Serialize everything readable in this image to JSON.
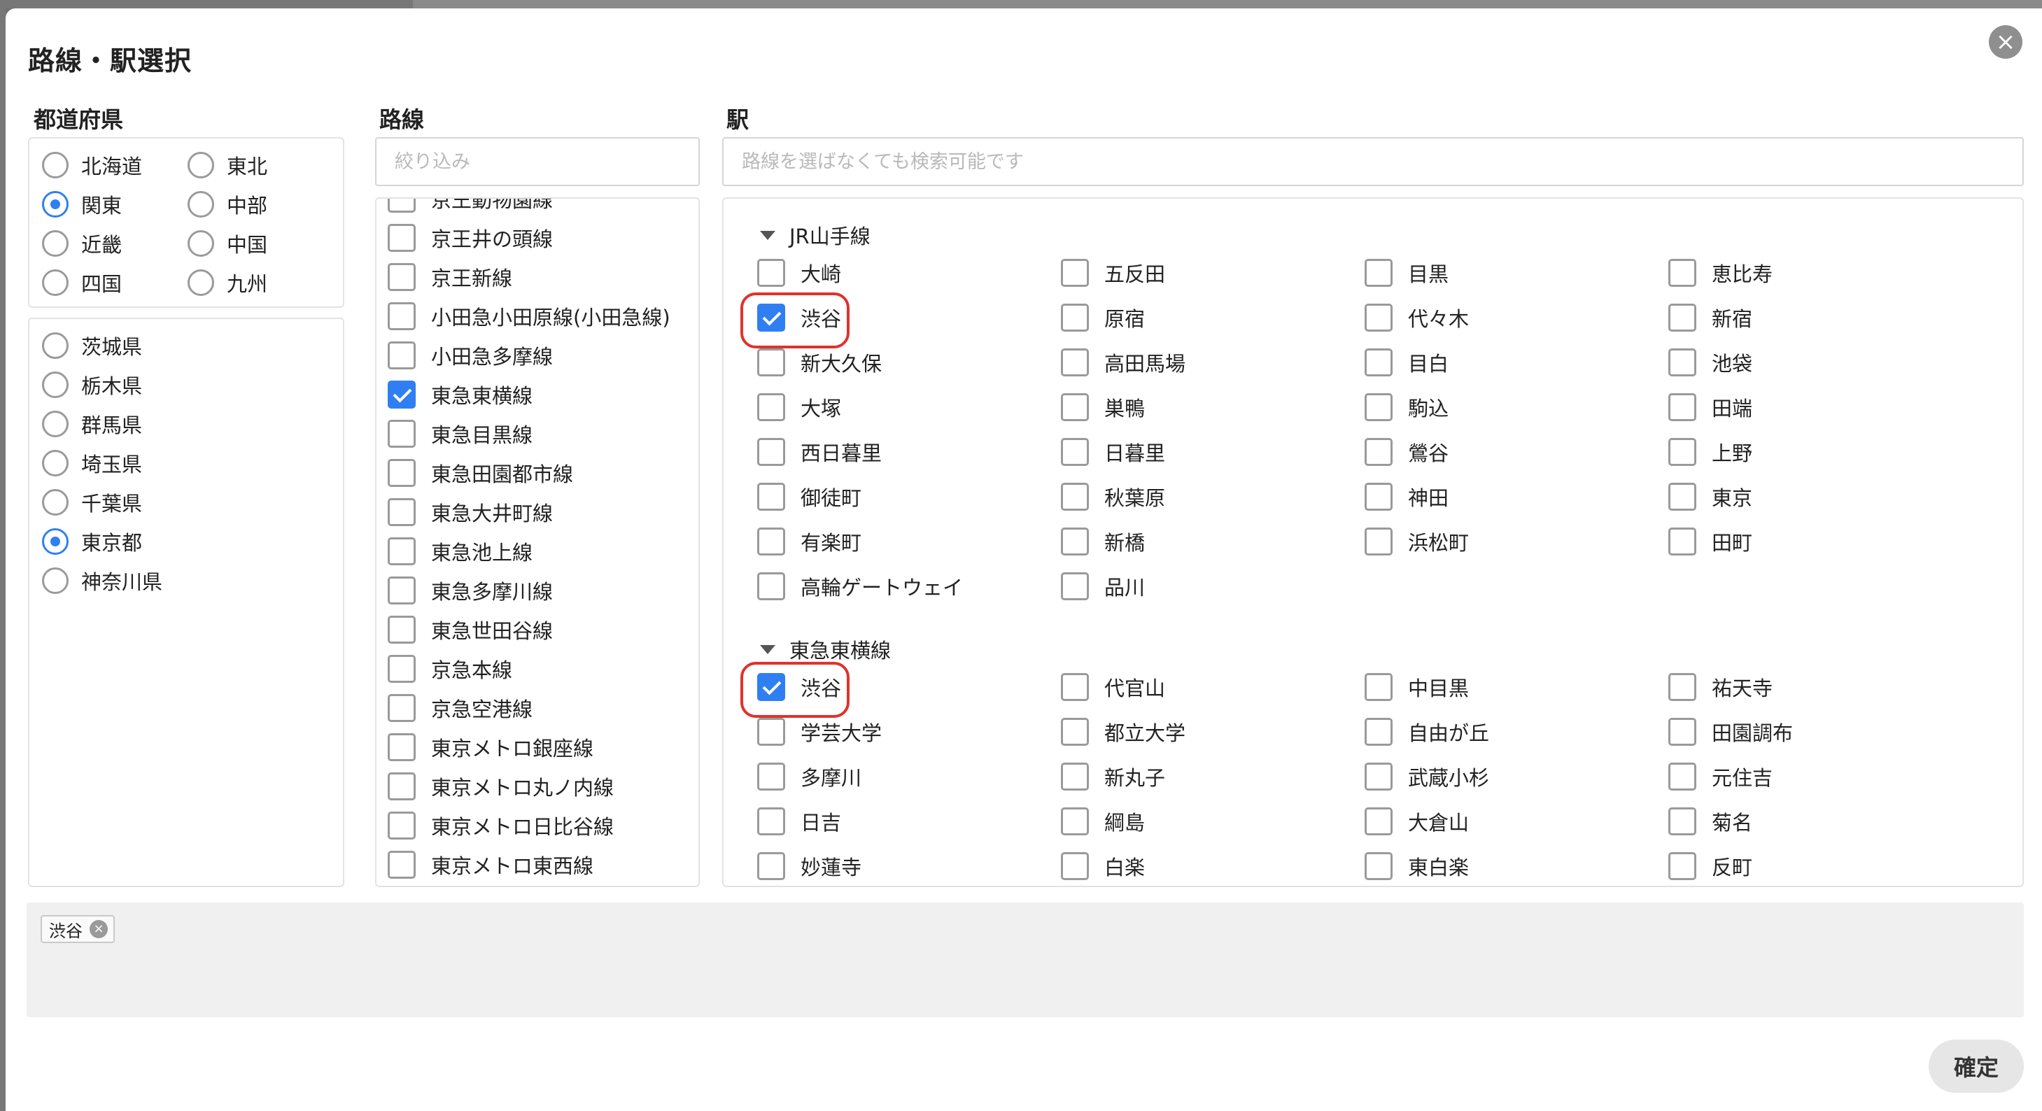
{
  "dialog": {
    "title": "路線・駅選択",
    "close_glyph": "×"
  },
  "columns": {
    "prefecture": "都道府県",
    "line": "路線",
    "station": "駅"
  },
  "regions": [
    {
      "label": "北海道",
      "selected": false
    },
    {
      "label": "東北",
      "selected": false
    },
    {
      "label": "関東",
      "selected": true
    },
    {
      "label": "中部",
      "selected": false
    },
    {
      "label": "近畿",
      "selected": false
    },
    {
      "label": "中国",
      "selected": false
    },
    {
      "label": "四国",
      "selected": false
    },
    {
      "label": "九州",
      "selected": false
    }
  ],
  "prefectures": [
    {
      "label": "茨城県",
      "selected": false
    },
    {
      "label": "栃木県",
      "selected": false
    },
    {
      "label": "群馬県",
      "selected": false
    },
    {
      "label": "埼玉県",
      "selected": false
    },
    {
      "label": "千葉県",
      "selected": false
    },
    {
      "label": "東京都",
      "selected": true
    },
    {
      "label": "神奈川県",
      "selected": false
    }
  ],
  "line_filter": {
    "placeholder": "絞り込み",
    "value": ""
  },
  "lines": [
    {
      "label": "京王動物園線",
      "checked": false
    },
    {
      "label": "京王井の頭線",
      "checked": false
    },
    {
      "label": "京王新線",
      "checked": false
    },
    {
      "label": "小田急小田原線(小田急線)",
      "checked": false
    },
    {
      "label": "小田急多摩線",
      "checked": false
    },
    {
      "label": "東急東横線",
      "checked": true
    },
    {
      "label": "東急目黒線",
      "checked": false
    },
    {
      "label": "東急田園都市線",
      "checked": false
    },
    {
      "label": "東急大井町線",
      "checked": false
    },
    {
      "label": "東急池上線",
      "checked": false
    },
    {
      "label": "東急多摩川線",
      "checked": false
    },
    {
      "label": "東急世田谷線",
      "checked": false
    },
    {
      "label": "京急本線",
      "checked": false
    },
    {
      "label": "京急空港線",
      "checked": false
    },
    {
      "label": "東京メトロ銀座線",
      "checked": false
    },
    {
      "label": "東京メトロ丸ノ内線",
      "checked": false
    },
    {
      "label": "東京メトロ日比谷線",
      "checked": false
    },
    {
      "label": "東京メトロ東西線",
      "checked": false
    }
  ],
  "station_filter": {
    "placeholder": "路線を選ばなくても検索可能です",
    "value": ""
  },
  "station_groups": [
    {
      "name": "JR山手線",
      "stations": [
        {
          "label": "大崎",
          "checked": false
        },
        {
          "label": "五反田",
          "checked": false
        },
        {
          "label": "目黒",
          "checked": false
        },
        {
          "label": "恵比寿",
          "checked": false
        },
        {
          "label": "渋谷",
          "checked": true
        },
        {
          "label": "原宿",
          "checked": false
        },
        {
          "label": "代々木",
          "checked": false
        },
        {
          "label": "新宿",
          "checked": false
        },
        {
          "label": "新大久保",
          "checked": false
        },
        {
          "label": "高田馬場",
          "checked": false
        },
        {
          "label": "目白",
          "checked": false
        },
        {
          "label": "池袋",
          "checked": false
        },
        {
          "label": "大塚",
          "checked": false
        },
        {
          "label": "巣鴨",
          "checked": false
        },
        {
          "label": "駒込",
          "checked": false
        },
        {
          "label": "田端",
          "checked": false
        },
        {
          "label": "西日暮里",
          "checked": false
        },
        {
          "label": "日暮里",
          "checked": false
        },
        {
          "label": "鶯谷",
          "checked": false
        },
        {
          "label": "上野",
          "checked": false
        },
        {
          "label": "御徒町",
          "checked": false
        },
        {
          "label": "秋葉原",
          "checked": false
        },
        {
          "label": "神田",
          "checked": false
        },
        {
          "label": "東京",
          "checked": false
        },
        {
          "label": "有楽町",
          "checked": false
        },
        {
          "label": "新橋",
          "checked": false
        },
        {
          "label": "浜松町",
          "checked": false
        },
        {
          "label": "田町",
          "checked": false
        },
        {
          "label": "高輪ゲートウェイ",
          "checked": false
        },
        {
          "label": "品川",
          "checked": false
        }
      ]
    },
    {
      "name": "東急東横線",
      "stations": [
        {
          "label": "渋谷",
          "checked": true
        },
        {
          "label": "代官山",
          "checked": false
        },
        {
          "label": "中目黒",
          "checked": false
        },
        {
          "label": "祐天寺",
          "checked": false
        },
        {
          "label": "学芸大学",
          "checked": false
        },
        {
          "label": "都立大学",
          "checked": false
        },
        {
          "label": "自由が丘",
          "checked": false
        },
        {
          "label": "田園調布",
          "checked": false
        },
        {
          "label": "多摩川",
          "checked": false
        },
        {
          "label": "新丸子",
          "checked": false
        },
        {
          "label": "武蔵小杉",
          "checked": false
        },
        {
          "label": "元住吉",
          "checked": false
        },
        {
          "label": "日吉",
          "checked": false
        },
        {
          "label": "綱島",
          "checked": false
        },
        {
          "label": "大倉山",
          "checked": false
        },
        {
          "label": "菊名",
          "checked": false
        },
        {
          "label": "妙蓮寺",
          "checked": false
        },
        {
          "label": "白楽",
          "checked": false
        },
        {
          "label": "東白楽",
          "checked": false
        },
        {
          "label": "反町",
          "checked": false
        }
      ]
    }
  ],
  "selected_chips": [
    {
      "label": "渋谷",
      "remove_glyph": "×"
    }
  ],
  "confirm_label": "確定",
  "colors": {
    "accent": "#2f7ff2",
    "highlight": "#e0322c"
  }
}
